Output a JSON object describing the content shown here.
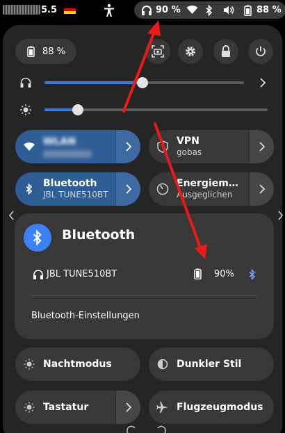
{
  "topbar": {
    "clock_suffix": "5.5",
    "headphones_battery": "90 %",
    "system_battery": "88 %"
  },
  "quick": {
    "battery": "88 %"
  },
  "sliders": {
    "volume_percent": 49,
    "brightness_percent": 15
  },
  "tiles": {
    "wlan": {
      "title": "WLAN",
      "subtitle": ""
    },
    "vpn": {
      "title": "VPN",
      "subtitle": "gobas"
    },
    "bluetooth": {
      "title": "Bluetooth",
      "subtitle": "JBL TUNE510BT"
    },
    "energy": {
      "title": "Energiem…",
      "subtitle": "Ausgeglichen"
    },
    "night": {
      "title": "Nachtmodus"
    },
    "dark_style": {
      "title": "Dunkler Stil"
    },
    "keyboard": {
      "title": "Tastatur"
    },
    "airplane": {
      "title": "Flugzeugmodus"
    }
  },
  "bluetooth_menu": {
    "title": "Bluetooth",
    "device_name": "JBL TUNE510BT",
    "device_battery": "90%",
    "settings_label": "Bluetooth-Einstellungen"
  },
  "colors": {
    "accent": "#3c82f6",
    "tile_active": "#2f5d96",
    "annotation_arrow": "#e81a1a"
  },
  "icons": [
    "headphones-icon",
    "battery-icon",
    "wifi-icon",
    "bluetooth-icon",
    "volume-icon",
    "accessibility-icon",
    "screenshot-icon",
    "gear-icon",
    "lock-icon",
    "power-icon",
    "brightness-icon",
    "shield-icon",
    "gauge-icon",
    "night-icon",
    "contrast-icon",
    "keyboard-icon",
    "airplane-icon"
  ]
}
